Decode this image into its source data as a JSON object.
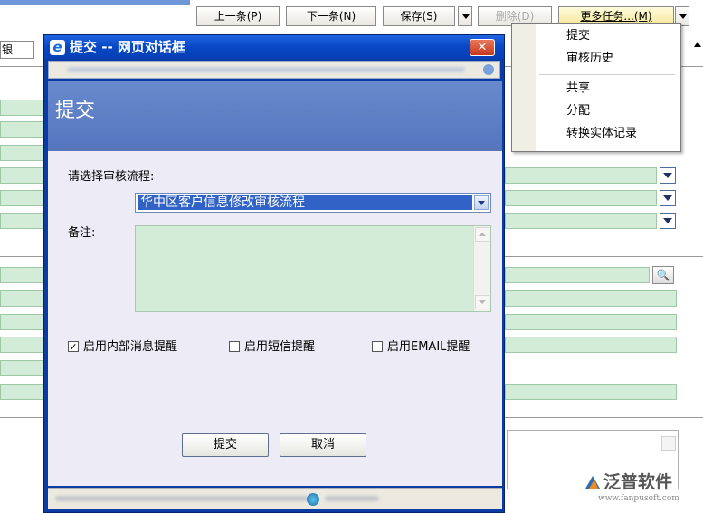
{
  "toolbar": {
    "prev_label": "上一条(P)",
    "next_label": "下一条(N)",
    "save_label": "保存(S)",
    "delete_label": "删除(D)",
    "more_tasks_label": "更多任务...(M)"
  },
  "background": {
    "tab_stub": "银"
  },
  "more_tasks_menu": {
    "items": [
      "提交",
      "审核历史",
      "共享",
      "分配",
      "转换实体记录"
    ]
  },
  "dialog": {
    "title": "提交 -- 网页对话框",
    "close_glyph": "✕",
    "header_title": "提交",
    "flow_label": "请选择审核流程:",
    "flow_selected": "华中区客户信息修改审核流程",
    "remark_label": "备注:",
    "remark_value": "",
    "checkboxes": [
      {
        "label": "启用内部消息提醒",
        "checked": true
      },
      {
        "label": "启用短信提醒",
        "checked": false
      },
      {
        "label": "启用EMAIL提醒",
        "checked": false
      }
    ],
    "submit_label": "提交",
    "cancel_label": "取消"
  },
  "watermark": {
    "name": "泛普软件",
    "url": "www.fanpusoft.com"
  },
  "colors": {
    "field_green": "#d3ecd8",
    "titlebar_blue": "#0847c4",
    "dialog_header": "#5f7fc6",
    "selected_blue": "#3162c6"
  }
}
